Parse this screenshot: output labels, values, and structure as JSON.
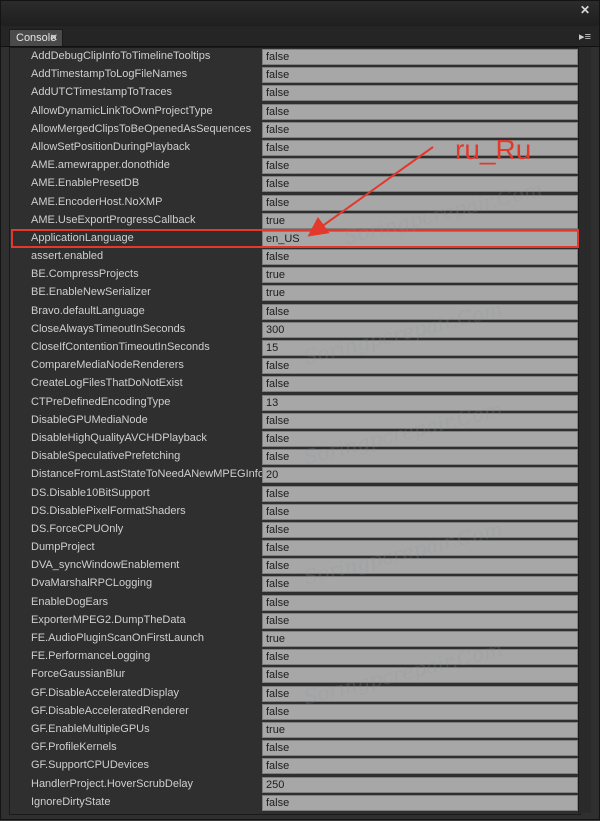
{
  "tab": {
    "label": "Console"
  },
  "annotation": {
    "label": "ru_Ru"
  },
  "rows": [
    {
      "name": "AddDebugClipInfoToTimelineTooltips",
      "value": "false"
    },
    {
      "name": "AddTimestampToLogFileNames",
      "value": "false"
    },
    {
      "name": "AddUTCTimestampToTraces",
      "value": "false"
    },
    {
      "name": "AllowDynamicLinkToOwnProjectType",
      "value": "false"
    },
    {
      "name": "AllowMergedClipsToBeOpenedAsSequences",
      "value": "false"
    },
    {
      "name": "AllowSetPositionDuringPlayback",
      "value": "false"
    },
    {
      "name": "AME.amewrapper.donothide",
      "value": "false"
    },
    {
      "name": "AME.EnablePresetDB",
      "value": "false"
    },
    {
      "name": "AME.EncoderHost.NoXMP",
      "value": "false"
    },
    {
      "name": "AME.UseExportProgressCallback",
      "value": "true"
    },
    {
      "name": "ApplicationLanguage",
      "value": "en_US"
    },
    {
      "name": "assert.enabled",
      "value": "false"
    },
    {
      "name": "BE.CompressProjects",
      "value": "true"
    },
    {
      "name": "BE.EnableNewSerializer",
      "value": "true"
    },
    {
      "name": "Bravo.defaultLanguage",
      "value": "false"
    },
    {
      "name": "CloseAlwaysTimeoutInSeconds",
      "value": "300"
    },
    {
      "name": "CloseIfContentionTimeoutInSeconds",
      "value": "15"
    },
    {
      "name": "CompareMediaNodeRenderers",
      "value": "false"
    },
    {
      "name": "CreateLogFilesThatDoNotExist",
      "value": "false"
    },
    {
      "name": "CTPreDefinedEncodingType",
      "value": "13"
    },
    {
      "name": "DisableGPUMediaNode",
      "value": "false"
    },
    {
      "name": "DisableHighQualityAVCHDPlayback",
      "value": "false"
    },
    {
      "name": "DisableSpeculativePrefetching",
      "value": "false"
    },
    {
      "name": "DistanceFromLastStateToNeedANewMPEGInfo",
      "value": "20"
    },
    {
      "name": "DS.Disable10BitSupport",
      "value": "false"
    },
    {
      "name": "DS.DisablePixelFormatShaders",
      "value": "false"
    },
    {
      "name": "DS.ForceCPUOnly",
      "value": "false"
    },
    {
      "name": "DumpProject",
      "value": "false"
    },
    {
      "name": "DVA_syncWindowEnablement",
      "value": "false"
    },
    {
      "name": "DvaMarshalRPCLogging",
      "value": "false"
    },
    {
      "name": "EnableDogEars",
      "value": "false"
    },
    {
      "name": "ExporterMPEG2.DumpTheData",
      "value": "false"
    },
    {
      "name": "FE.AudioPluginScanOnFirstLaunch",
      "value": "true"
    },
    {
      "name": "FE.PerformanceLogging",
      "value": "false"
    },
    {
      "name": "ForceGaussianBlur",
      "value": "false"
    },
    {
      "name": "GF.DisableAcceleratedDisplay",
      "value": "false"
    },
    {
      "name": "GF.DisableAcceleratedRenderer",
      "value": "false"
    },
    {
      "name": "GF.EnableMultipleGPUs",
      "value": "true"
    },
    {
      "name": "GF.ProfileKernels",
      "value": "false"
    },
    {
      "name": "GF.SupportCPUDevices",
      "value": "false"
    },
    {
      "name": "HandlerProject.HoverScrubDelay",
      "value": "250"
    },
    {
      "name": "IgnoreDirtyState",
      "value": "false"
    }
  ],
  "colors": {
    "annotation": "#e3382c"
  }
}
